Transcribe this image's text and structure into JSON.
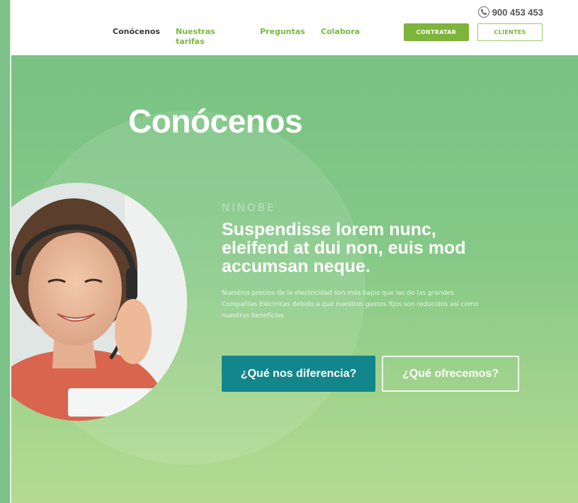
{
  "header": {
    "phone": "900 453 453",
    "nav": [
      {
        "label": "Conócenos",
        "active": true
      },
      {
        "label": "Nuestras tarifas",
        "active": false
      },
      {
        "label": "Preguntas",
        "active": false
      },
      {
        "label": "Colabora",
        "active": false
      }
    ],
    "contratar_label": "CONTRATAR",
    "clientes_label": "CLIENTES"
  },
  "hero": {
    "title": "Conócenos",
    "brand": "NINOBE",
    "headline": "Suspendisse lorem nunc, eleifend at dui non, euis mod accumsan neque.",
    "description": "Nuestros precios de la electricidad son más bajos que las de las grandes Compañías Eléctricas debido a que nuestros gastos fijos son reducidos así como nuestros beneficios",
    "button_primary": "¿Qué nos diferencia?",
    "button_secondary": "¿Qué ofrecemos?"
  },
  "icons": {
    "phone": "phone-icon"
  },
  "colors": {
    "accent_green": "#7db43a",
    "hero_green": "#7cc283",
    "teal_button": "#12868b"
  }
}
